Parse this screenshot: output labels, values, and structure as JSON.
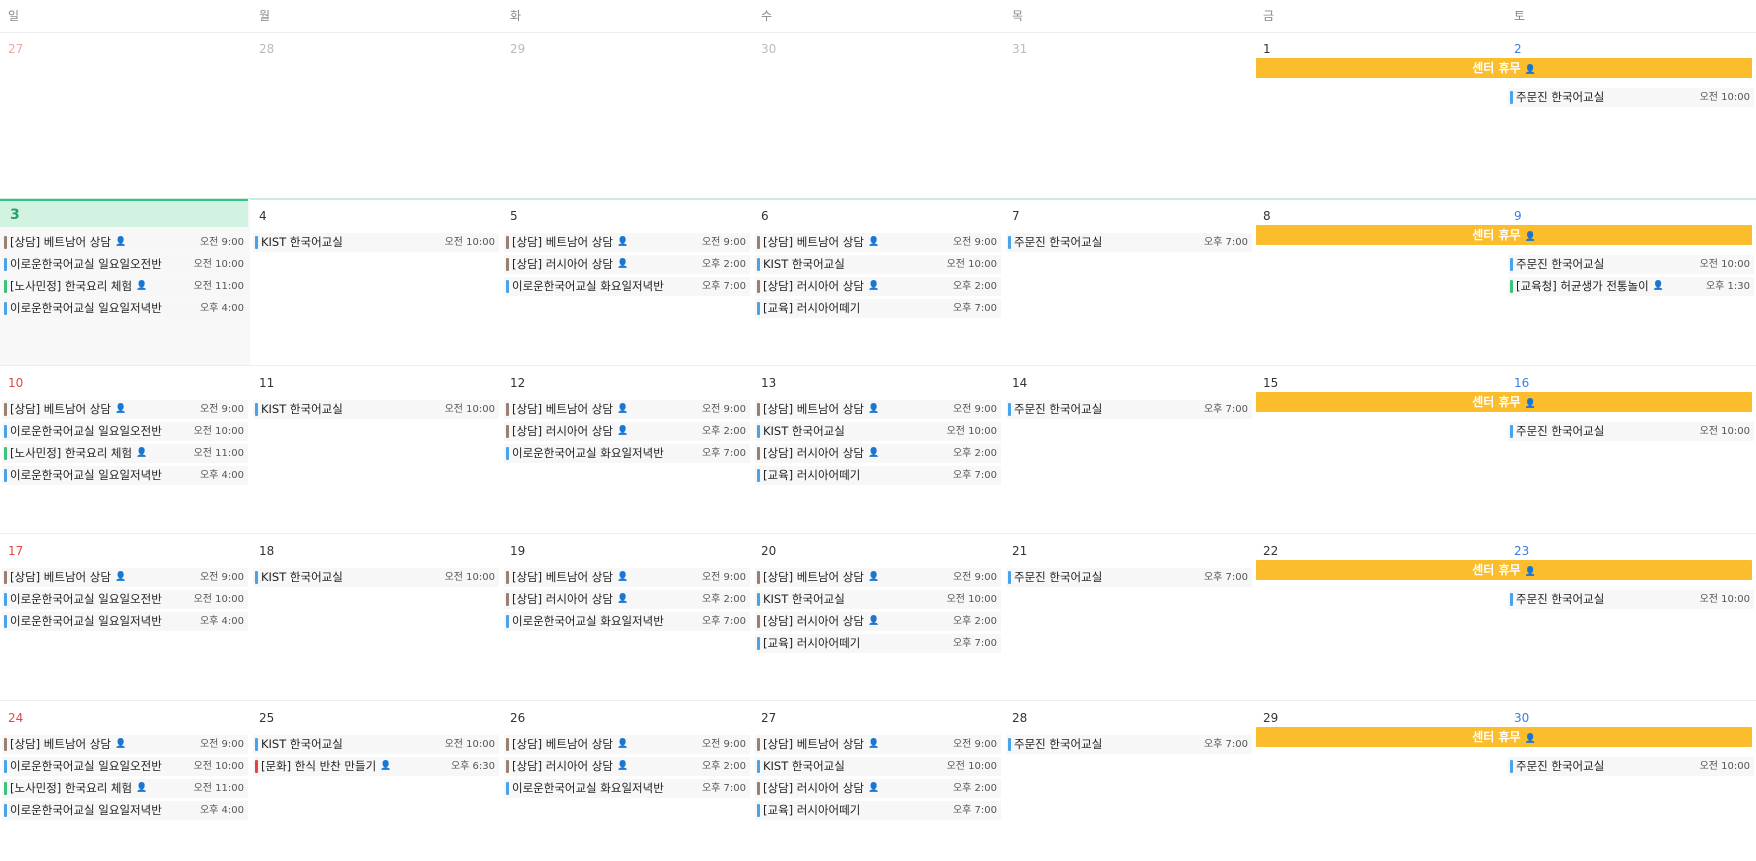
{
  "weekdays": [
    "일",
    "월",
    "화",
    "수",
    "목",
    "금",
    "토"
  ],
  "colors": {
    "consult": "#9a7f73",
    "blue": "#4aa3e8",
    "green": "#3cc37a",
    "red": "#e2453c",
    "allday": "#fbbd2c",
    "today_bg": "#d2f2e2",
    "today_text": "#20a56c",
    "sunday": "#e04848",
    "saturday": "#3b7ee0"
  },
  "person_icon": "person-icon",
  "weeks": [
    {
      "days": [
        {
          "num": "27",
          "other": true,
          "events": []
        },
        {
          "num": "28",
          "other": true,
          "events": []
        },
        {
          "num": "29",
          "other": true,
          "events": []
        },
        {
          "num": "30",
          "other": true,
          "events": []
        },
        {
          "num": "31",
          "other": true,
          "events": []
        },
        {
          "num": "1",
          "events": []
        },
        {
          "num": "2",
          "events": [
            {
              "title": "주문진 한국어교실",
              "time": "오전 10:00",
              "color": "blue"
            }
          ]
        }
      ],
      "allday": {
        "title": "센터 휴무",
        "person": true
      }
    },
    {
      "current": true,
      "days": [
        {
          "num": "3",
          "today": true,
          "events": [
            {
              "title": "[상담] 베트남어 상담",
              "person": true,
              "time": "오전 9:00",
              "color": "consult"
            },
            {
              "title": "이로운한국어교실 일요일오전반",
              "time": "오전 10:00",
              "color": "blue"
            },
            {
              "title": "[노사민정] 한국요리 체험",
              "person": true,
              "time": "오전 11:00",
              "color": "green"
            },
            {
              "title": "이로운한국어교실 일요일저녁반",
              "time": "오후 4:00",
              "color": "blue"
            }
          ]
        },
        {
          "num": "4",
          "events": [
            {
              "title": "KIST 한국어교실",
              "time": "오전 10:00",
              "color": "blue"
            }
          ]
        },
        {
          "num": "5",
          "events": [
            {
              "title": "[상담] 베트남어 상담",
              "person": true,
              "time": "오전 9:00",
              "color": "consult"
            },
            {
              "title": "[상담] 러시아어 상담",
              "person": true,
              "time": "오후 2:00",
              "color": "consult"
            },
            {
              "title": "이로운한국어교실 화요일저녁반",
              "time": "오후 7:00",
              "color": "blue"
            }
          ]
        },
        {
          "num": "6",
          "events": [
            {
              "title": "[상담] 베트남어 상담",
              "person": true,
              "time": "오전 9:00",
              "color": "consult"
            },
            {
              "title": "KIST 한국어교실",
              "time": "오전 10:00",
              "color": "blue"
            },
            {
              "title": "[상담] 러시아어 상담",
              "person": true,
              "time": "오후 2:00",
              "color": "consult"
            },
            {
              "title": "[교육] 러시아어떼기",
              "time": "오후 7:00",
              "color": "blue"
            }
          ]
        },
        {
          "num": "7",
          "events": [
            {
              "title": "주문진 한국어교실",
              "time": "오후 7:00",
              "color": "blue"
            }
          ]
        },
        {
          "num": "8",
          "events": []
        },
        {
          "num": "9",
          "events": [
            {
              "title": "주문진 한국어교실",
              "time": "오전 10:00",
              "color": "blue"
            },
            {
              "title": "[교육청] 허균생가 전통놀이",
              "person": true,
              "time": "오후 1:30",
              "color": "green"
            }
          ]
        }
      ],
      "allday": {
        "title": "센터 휴무",
        "person": true
      }
    },
    {
      "days": [
        {
          "num": "10",
          "events": [
            {
              "title": "[상담] 베트남어 상담",
              "person": true,
              "time": "오전 9:00",
              "color": "consult"
            },
            {
              "title": "이로운한국어교실 일요일오전반",
              "time": "오전 10:00",
              "color": "blue"
            },
            {
              "title": "[노사민정] 한국요리 체험",
              "person": true,
              "time": "오전 11:00",
              "color": "green"
            },
            {
              "title": "이로운한국어교실 일요일저녁반",
              "time": "오후 4:00",
              "color": "blue"
            }
          ]
        },
        {
          "num": "11",
          "events": [
            {
              "title": "KIST 한국어교실",
              "time": "오전 10:00",
              "color": "blue"
            }
          ]
        },
        {
          "num": "12",
          "events": [
            {
              "title": "[상담] 베트남어 상담",
              "person": true,
              "time": "오전 9:00",
              "color": "consult"
            },
            {
              "title": "[상담] 러시아어 상담",
              "person": true,
              "time": "오후 2:00",
              "color": "consult"
            },
            {
              "title": "이로운한국어교실 화요일저녁반",
              "time": "오후 7:00",
              "color": "blue"
            }
          ]
        },
        {
          "num": "13",
          "events": [
            {
              "title": "[상담] 베트남어 상담",
              "person": true,
              "time": "오전 9:00",
              "color": "consult"
            },
            {
              "title": "KIST 한국어교실",
              "time": "오전 10:00",
              "color": "blue"
            },
            {
              "title": "[상담] 러시아어 상담",
              "person": true,
              "time": "오후 2:00",
              "color": "consult"
            },
            {
              "title": "[교육] 러시아어떼기",
              "time": "오후 7:00",
              "color": "blue"
            }
          ]
        },
        {
          "num": "14",
          "events": [
            {
              "title": "주문진 한국어교실",
              "time": "오후 7:00",
              "color": "blue"
            }
          ]
        },
        {
          "num": "15",
          "events": []
        },
        {
          "num": "16",
          "events": [
            {
              "title": "주문진 한국어교실",
              "time": "오전 10:00",
              "color": "blue"
            }
          ]
        }
      ],
      "allday": {
        "title": "센터 휴무",
        "person": true
      }
    },
    {
      "days": [
        {
          "num": "17",
          "events": [
            {
              "title": "[상담] 베트남어 상담",
              "person": true,
              "time": "오전 9:00",
              "color": "consult"
            },
            {
              "title": "이로운한국어교실 일요일오전반",
              "time": "오전 10:00",
              "color": "blue"
            },
            {
              "title": "이로운한국어교실 일요일저녁반",
              "time": "오후 4:00",
              "color": "blue"
            }
          ]
        },
        {
          "num": "18",
          "events": [
            {
              "title": "KIST 한국어교실",
              "time": "오전 10:00",
              "color": "blue"
            }
          ]
        },
        {
          "num": "19",
          "events": [
            {
              "title": "[상담] 베트남어 상담",
              "person": true,
              "time": "오전 9:00",
              "color": "consult"
            },
            {
              "title": "[상담] 러시아어 상담",
              "person": true,
              "time": "오후 2:00",
              "color": "consult"
            },
            {
              "title": "이로운한국어교실 화요일저녁반",
              "time": "오후 7:00",
              "color": "blue"
            }
          ]
        },
        {
          "num": "20",
          "events": [
            {
              "title": "[상담] 베트남어 상담",
              "person": true,
              "time": "오전 9:00",
              "color": "consult"
            },
            {
              "title": "KIST 한국어교실",
              "time": "오전 10:00",
              "color": "blue"
            },
            {
              "title": "[상담] 러시아어 상담",
              "person": true,
              "time": "오후 2:00",
              "color": "consult"
            },
            {
              "title": "[교육] 러시아어떼기",
              "time": "오후 7:00",
              "color": "blue"
            }
          ]
        },
        {
          "num": "21",
          "events": [
            {
              "title": "주문진 한국어교실",
              "time": "오후 7:00",
              "color": "blue"
            }
          ]
        },
        {
          "num": "22",
          "events": []
        },
        {
          "num": "23",
          "events": [
            {
              "title": "주문진 한국어교실",
              "time": "오전 10:00",
              "color": "blue"
            }
          ]
        }
      ],
      "allday": {
        "title": "센터 휴무",
        "person": true
      }
    },
    {
      "days": [
        {
          "num": "24",
          "events": [
            {
              "title": "[상담] 베트남어 상담",
              "person": true,
              "time": "오전 9:00",
              "color": "consult"
            },
            {
              "title": "이로운한국어교실 일요일오전반",
              "time": "오전 10:00",
              "color": "blue"
            },
            {
              "title": "[노사민정] 한국요리 체험",
              "person": true,
              "time": "오전 11:00",
              "color": "green"
            },
            {
              "title": "이로운한국어교실 일요일저녁반",
              "time": "오후 4:00",
              "color": "blue"
            }
          ]
        },
        {
          "num": "25",
          "events": [
            {
              "title": "KIST 한국어교실",
              "time": "오전 10:00",
              "color": "blue"
            },
            {
              "title": "[문화] 한식 반찬 만들기",
              "person": true,
              "time": "오후 6:30",
              "color": "red"
            }
          ]
        },
        {
          "num": "26",
          "events": [
            {
              "title": "[상담] 베트남어 상담",
              "person": true,
              "time": "오전 9:00",
              "color": "consult"
            },
            {
              "title": "[상담] 러시아어 상담",
              "person": true,
              "time": "오후 2:00",
              "color": "consult"
            },
            {
              "title": "이로운한국어교실 화요일저녁반",
              "time": "오후 7:00",
              "color": "blue"
            }
          ]
        },
        {
          "num": "27",
          "events": [
            {
              "title": "[상담] 베트남어 상담",
              "person": true,
              "time": "오전 9:00",
              "color": "consult"
            },
            {
              "title": "KIST 한국어교실",
              "time": "오전 10:00",
              "color": "blue"
            },
            {
              "title": "[상담] 러시아어 상담",
              "person": true,
              "time": "오후 2:00",
              "color": "consult"
            },
            {
              "title": "[교육] 러시아어떼기",
              "time": "오후 7:00",
              "color": "blue"
            }
          ]
        },
        {
          "num": "28",
          "events": [
            {
              "title": "주문진 한국어교실",
              "time": "오후 7:00",
              "color": "blue"
            }
          ]
        },
        {
          "num": "29",
          "events": []
        },
        {
          "num": "30",
          "events": [
            {
              "title": "주문진 한국어교실",
              "time": "오전 10:00",
              "color": "blue"
            }
          ]
        }
      ],
      "allday": {
        "title": "센터 휴무",
        "person": true
      }
    }
  ]
}
